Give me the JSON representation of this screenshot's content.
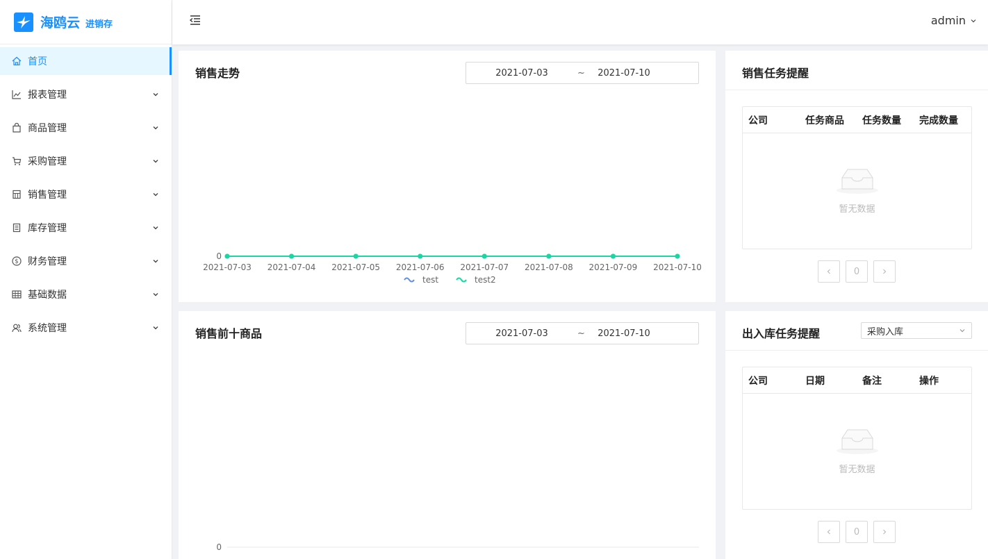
{
  "app": {
    "name": "海鸥云",
    "sub": "进销存"
  },
  "colors": {
    "primary": "#1890ff",
    "series_test": "#5b8ff9",
    "series_test2": "#1ad7a1"
  },
  "sidebar": {
    "items": [
      {
        "label": "首页",
        "icon": "home-icon",
        "active": true
      },
      {
        "label": "报表管理",
        "icon": "line-chart-icon"
      },
      {
        "label": "商品管理",
        "icon": "shopping-bag-icon"
      },
      {
        "label": "采购管理",
        "icon": "cart-icon"
      },
      {
        "label": "销售管理",
        "icon": "calculator-icon"
      },
      {
        "label": "库存管理",
        "icon": "list-box-icon"
      },
      {
        "label": "财务管理",
        "icon": "dollar-icon"
      },
      {
        "label": "基础数据",
        "icon": "table-icon"
      },
      {
        "label": "系统管理",
        "icon": "users-icon"
      }
    ]
  },
  "header": {
    "user": "admin"
  },
  "sales_trend": {
    "title": "销售走势",
    "date_from": "2021-07-03",
    "separator": "~",
    "date_to": "2021-07-10"
  },
  "top10": {
    "title": "销售前十商品",
    "date_from": "2021-07-03",
    "separator": "~",
    "date_to": "2021-07-10",
    "y_tick": "0"
  },
  "sales_task": {
    "title": "销售任务提醒",
    "columns": [
      "公司",
      "任务商品",
      "任务数量",
      "完成数量"
    ],
    "empty": "暂无数据",
    "page": "0"
  },
  "stock_task": {
    "title": "出入库任务提醒",
    "select": "采购入库",
    "columns": [
      "公司",
      "日期",
      "备注",
      "操作"
    ],
    "empty": "暂无数据",
    "page": "0"
  },
  "chart_data": {
    "type": "line",
    "title": "销售走势",
    "x": [
      "2021-07-03",
      "2021-07-04",
      "2021-07-05",
      "2021-07-06",
      "2021-07-07",
      "2021-07-08",
      "2021-07-09",
      "2021-07-10"
    ],
    "series": [
      {
        "name": "test",
        "values": [
          0,
          0,
          0,
          0,
          0,
          0,
          0,
          0
        ]
      },
      {
        "name": "test2",
        "values": [
          0,
          0,
          0,
          0,
          0,
          0,
          0,
          0
        ]
      }
    ],
    "y_ticks": [
      "0"
    ],
    "legend": "bottom"
  }
}
